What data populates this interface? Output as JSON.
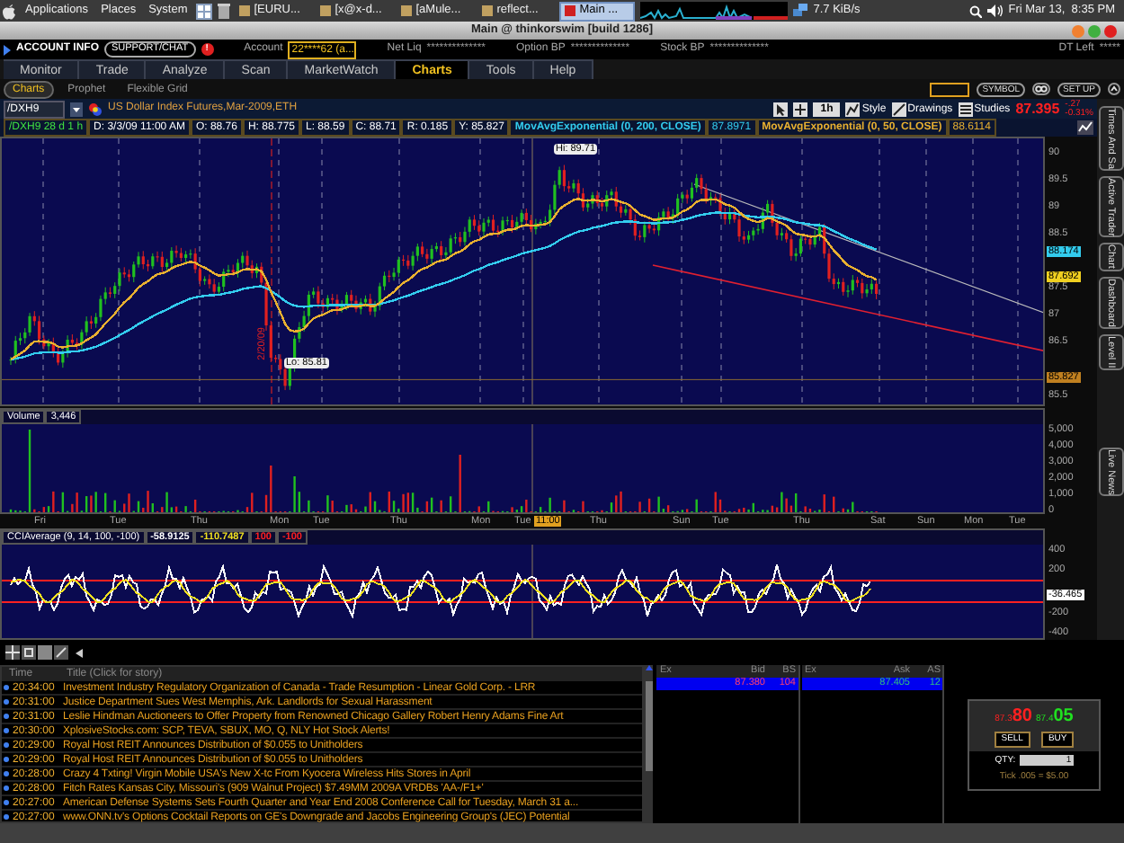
{
  "os_bar": {
    "menus": [
      "Applications",
      "Places",
      "System"
    ],
    "tasks": [
      {
        "label": "[EURU...",
        "selected": false
      },
      {
        "label": "[x@x-d...",
        "selected": false
      },
      {
        "label": "[aMule...",
        "selected": false
      },
      {
        "label": "reflect...",
        "selected": false
      },
      {
        "label": "Main ...",
        "selected": true
      }
    ],
    "network": "7.7 KiB/s",
    "clock": "Fri Mar 13,  8:35 PM"
  },
  "window": {
    "title": "Main @ thinkorswim [build 1286]"
  },
  "account_bar": {
    "title": "ACCOUNT INFO",
    "support": "SUPPORT/CHAT",
    "alert": "!",
    "account_label": "Account",
    "account": "22****62 (a...",
    "fields": [
      {
        "label": "Net Liq",
        "value": "**************"
      },
      {
        "label": "Option BP",
        "value": "**************"
      },
      {
        "label": "Stock BP",
        "value": "**************"
      },
      {
        "label": "DT Left",
        "value": "*****"
      }
    ]
  },
  "tabs": [
    {
      "label": "Monitor",
      "selected": false
    },
    {
      "label": "Trade",
      "selected": false
    },
    {
      "label": "Analyze",
      "selected": false
    },
    {
      "label": "Scan",
      "selected": false
    },
    {
      "label": "MarketWatch",
      "selected": false
    },
    {
      "label": "Charts",
      "selected": true
    },
    {
      "label": "Tools",
      "selected": false
    },
    {
      "label": "Help",
      "selected": false
    }
  ],
  "subtabs": [
    {
      "label": "Charts",
      "selected": true
    },
    {
      "label": "Prophet",
      "selected": false
    },
    {
      "label": "Flexible Grid",
      "selected": false
    }
  ],
  "subtab_buttons": [
    "SYMBOL",
    "SET UP"
  ],
  "symbol_bar": {
    "symbol": "/DXH9",
    "description": "US Dollar Index Futures,Mar-2009,ETH",
    "period": "1h",
    "buttons": [
      "Style",
      "Drawings",
      "Studies"
    ],
    "last": "87.395",
    "change": "-.27",
    "change_pct": "-0.31%"
  },
  "chart_info": {
    "items": [
      "/DXH9 28 d 1 h",
      "D: 3/3/09 11:00 AM",
      "O: 88.76",
      "H: 88.775",
      "L: 88.59",
      "C: 88.71",
      "R: 0.185",
      "Y: 85.827"
    ],
    "studies": [
      {
        "name": "MovAvgExponential (0, 200, CLOSE)",
        "value": "87.8971",
        "color": "#33ccee"
      },
      {
        "name": "MovAvgExponential (0, 50, CLOSE)",
        "value": "88.6114",
        "color": "#e8b030"
      }
    ]
  },
  "price_chart": {
    "yticks": [
      "90",
      "89.5",
      "89",
      "88.5",
      "87.5",
      "87",
      "86.5",
      "85.5"
    ],
    "badges": [
      {
        "value": "88.174",
        "color": "#33ccee"
      },
      {
        "value": "87.692",
        "color": "#f0d020"
      },
      {
        "value": "85.827",
        "color": "#c08020"
      }
    ],
    "high_label": "Hi: 89.71",
    "low_label": "Lo: 85.81",
    "date_marker": "2/20/09"
  },
  "side_tabs": [
    "Times And Sa",
    "Active Trader",
    "Chart",
    "Dashboard",
    "Level II",
    "Live News"
  ],
  "volume": {
    "label": "Volume",
    "value": "3,446",
    "yticks": [
      "5,000",
      "4,000",
      "3,000",
      "2,000",
      "1,000",
      "0"
    ]
  },
  "xaxis": [
    "Fri",
    "Tue",
    "Thu",
    "Mon",
    "Tue",
    "Thu",
    "Mon",
    "Tue",
    "11:00",
    "Thu",
    "Sun",
    "Tue",
    "Thu",
    "Sat",
    "Sun",
    "Mon",
    "Tue"
  ],
  "cci": {
    "label": "CCIAverage (9, 14, 100, -100)",
    "values": [
      {
        "value": "-58.9125",
        "color": "#ffffff"
      },
      {
        "value": "-110.7487",
        "color": "#f0e020"
      },
      {
        "value": "100",
        "color": "#ff2020"
      },
      {
        "value": "-100",
        "color": "#ff2020"
      }
    ],
    "yticks": [
      "400",
      "200",
      "-200",
      "-400"
    ],
    "badge": "-36.465"
  },
  "news": {
    "columns": [
      "Time",
      "Title (Click for story)"
    ],
    "rows": [
      {
        "time": "20:34:00",
        "title": "Investment Industry Regulatory Organization of Canada - Trade Resumption - Linear Gold Corp. - LRR"
      },
      {
        "time": "20:31:00",
        "title": "Justice Department Sues West Memphis, Ark. Landlords for Sexual Harassment"
      },
      {
        "time": "20:31:00",
        "title": "Leslie Hindman Auctioneers to Offer Property from Renowned Chicago Gallery Robert Henry Adams Fine Art"
      },
      {
        "time": "20:30:00",
        "title": "XplosiveStocks.com: SCP, TEVA, SBUX, MO, Q, NLY Hot Stock Alerts!"
      },
      {
        "time": "20:29:00",
        "title": "Royal Host REIT Announces Distribution of $0.055 to Unitholders"
      },
      {
        "time": "20:29:00",
        "title": "Royal Host REIT Announces Distribution of $0.055 to Unitholders"
      },
      {
        "time": "20:28:00",
        "title": "Crazy 4 Txting! Virgin Mobile USA's New X-tc From Kyocera Wireless Hits Stores in April"
      },
      {
        "time": "20:28:00",
        "title": "Fitch Rates Kansas City, Missouri's (909 Walnut Project) $7.49MM 2009A VRDBs 'AA-/F1+'"
      },
      {
        "time": "20:27:00",
        "title": "American Defense Systems Sets Fourth Quarter and Year End 2008 Conference Call for Tuesday, March 31 a..."
      },
      {
        "time": "20:27:00",
        "title": "www.ONN.tv's Options Cocktail Reports on GE's Downgrade and Jacobs Engineering Group's (JEC) Potential"
      }
    ]
  },
  "level2": {
    "bid_columns": [
      "Ex",
      "Bid",
      "BS"
    ],
    "ask_columns": [
      "Ex",
      "Ask",
      "AS"
    ],
    "bid": {
      "price": "87.380",
      "size": "104"
    },
    "ask": {
      "price": "87.405",
      "size": "12"
    }
  },
  "trade_box": {
    "bid_prefix": "87.3",
    "bid_big": "80",
    "ask_prefix": "87.4",
    "ask_big": "05",
    "sell": "SELL",
    "buy": "BUY",
    "qty_label": "QTY:",
    "qty": "1",
    "tick": "Tick .005 = $5.00"
  }
}
